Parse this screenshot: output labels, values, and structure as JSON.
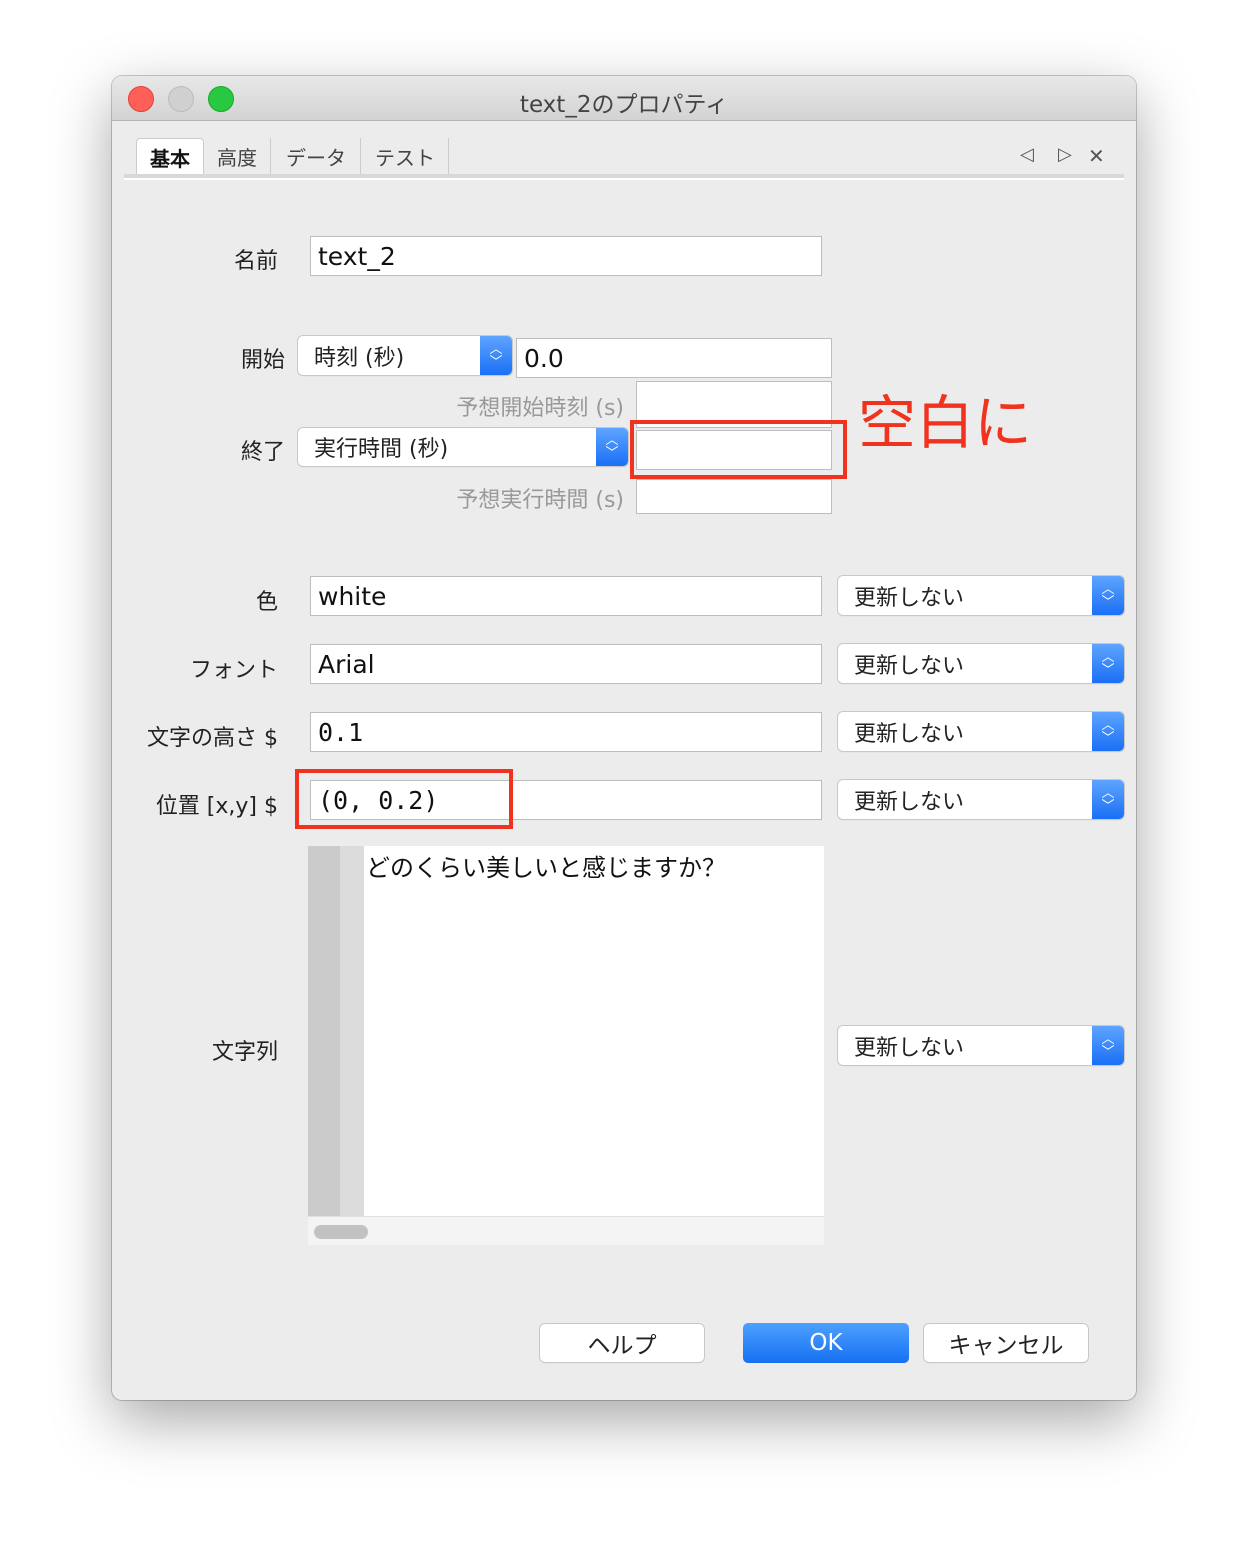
{
  "window": {
    "title": "text_2のプロパティ",
    "traffic_lights": {
      "close": "#fe5f57",
      "minimize": "#d0d0d0",
      "zoom": "#28c840"
    }
  },
  "tabs": [
    {
      "label": "基本",
      "active": true
    },
    {
      "label": "高度"
    },
    {
      "label": "データ"
    },
    {
      "label": "テスト"
    }
  ],
  "tab_controls": {
    "prev": "◁",
    "next": "▷",
    "close": "✕"
  },
  "form": {
    "name": {
      "label": "名前",
      "value": "text_2"
    },
    "start": {
      "label": "開始",
      "type": "時刻 (秒)",
      "value": "0.0",
      "expected_label": "予想開始時刻 (s)",
      "expected_value": ""
    },
    "stop": {
      "label": "終了",
      "type": "実行時間 (秒)",
      "value": "",
      "expected_label": "予想実行時間 (s)",
      "expected_value": ""
    },
    "color": {
      "label": "色",
      "value": "white",
      "update": "更新しない"
    },
    "font": {
      "label": "フォント",
      "value": "Arial",
      "update": "更新しない"
    },
    "letter_height": {
      "label": "文字の高さ $",
      "value": "0.1",
      "update": "更新しない"
    },
    "position": {
      "label": "位置 [x,y] $",
      "value": "(0, 0.2)",
      "update": "更新しない"
    },
    "text": {
      "label": "文字列",
      "value": "どのくらい美しいと感じますか？",
      "update": "更新しない"
    }
  },
  "annotation": {
    "text": "空白に",
    "color": "#f0321e"
  },
  "buttons": {
    "help": "ヘルプ",
    "ok": "OK",
    "cancel": "キャンセル"
  },
  "accent": "#1a6ff5"
}
